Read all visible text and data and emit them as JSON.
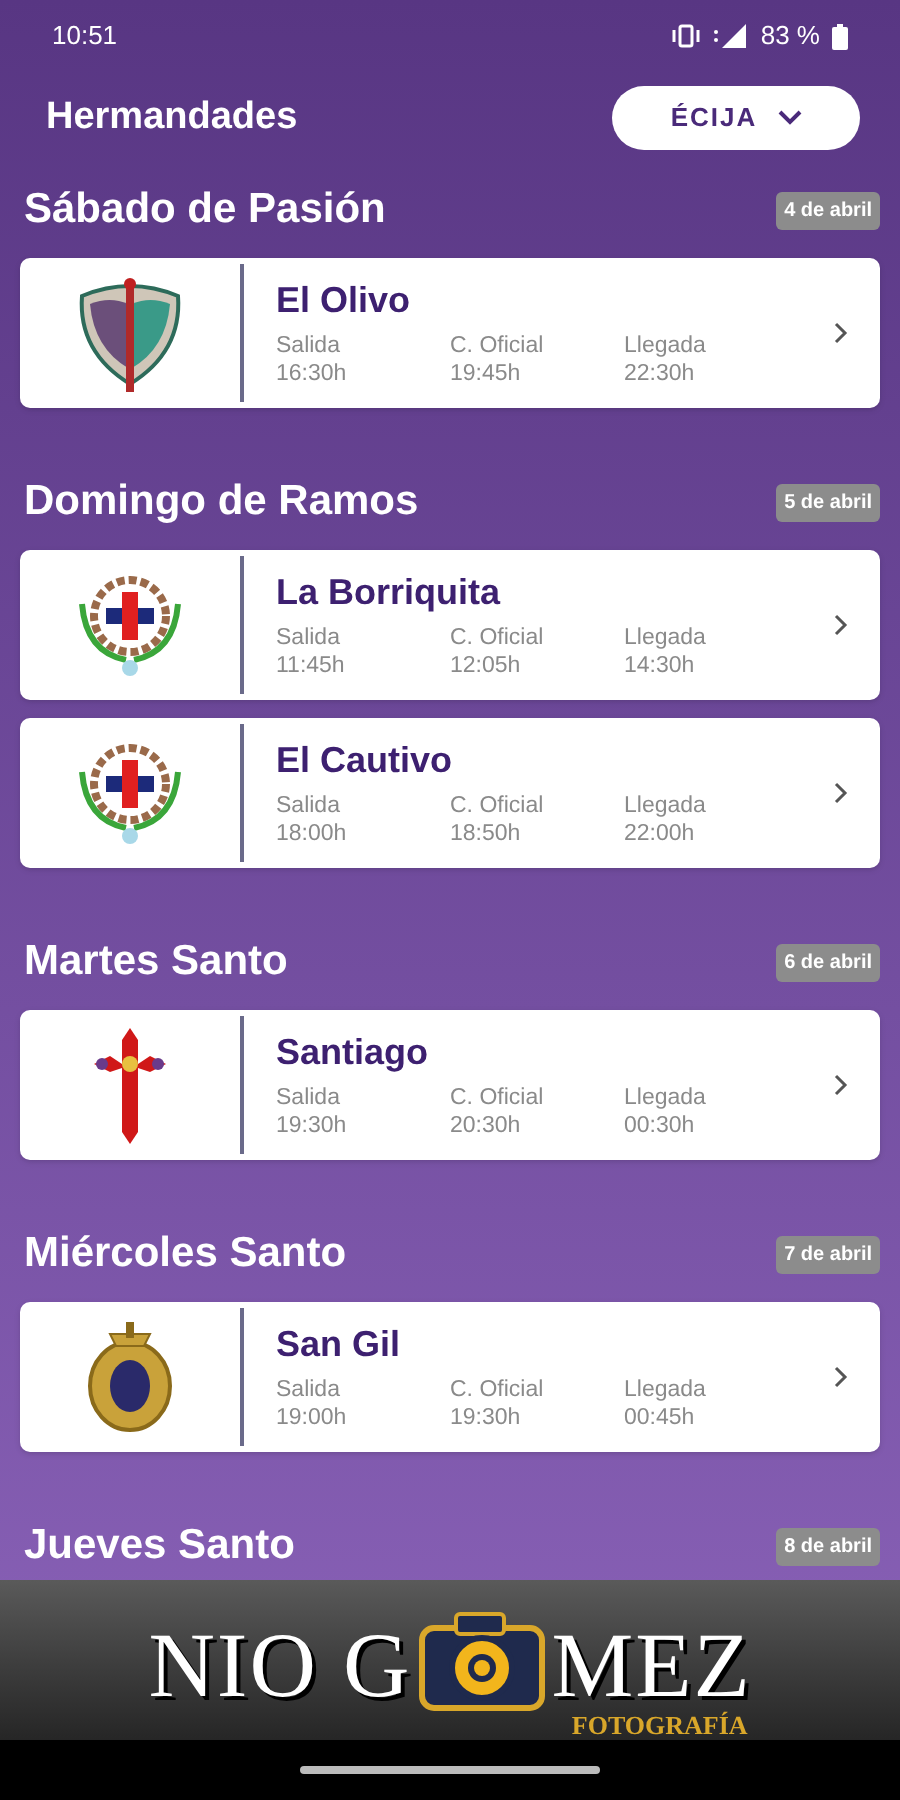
{
  "status_bar": {
    "time": "10:51",
    "battery": "83 %"
  },
  "header": {
    "title": "Hermandades",
    "city_selector": "ÉCIJA"
  },
  "days": [
    {
      "name": "Sábado de Pasión",
      "date": "4 de abril",
      "processions": [
        {
          "name": "El Olivo",
          "kind": "shield",
          "times": [
            {
              "label": "Salida",
              "value": "16:30h"
            },
            {
              "label": "C. Oficial",
              "value": "19:45h"
            },
            {
              "label": "Llegada",
              "value": "22:30h"
            }
          ]
        }
      ]
    },
    {
      "name": "Domingo de Ramos",
      "date": "5 de abril",
      "processions": [
        {
          "name": "La Borriquita",
          "kind": "wreath",
          "times": [
            {
              "label": "Salida",
              "value": "11:45h"
            },
            {
              "label": "C. Oficial",
              "value": "12:05h"
            },
            {
              "label": "Llegada",
              "value": "14:30h"
            }
          ]
        },
        {
          "name": "El Cautivo",
          "kind": "wreath",
          "times": [
            {
              "label": "Salida",
              "value": "18:00h"
            },
            {
              "label": "C. Oficial",
              "value": "18:50h"
            },
            {
              "label": "Llegada",
              "value": "22:00h"
            }
          ]
        }
      ]
    },
    {
      "name": "Martes Santo",
      "date": "6 de abril",
      "processions": [
        {
          "name": "Santiago",
          "kind": "sword-cross",
          "times": [
            {
              "label": "Salida",
              "value": "19:30h"
            },
            {
              "label": "C. Oficial",
              "value": "20:30h"
            },
            {
              "label": "Llegada",
              "value": "00:30h"
            }
          ]
        }
      ]
    },
    {
      "name": "Miércoles Santo",
      "date": "7 de abril",
      "processions": [
        {
          "name": "San Gil",
          "kind": "medallion",
          "times": [
            {
              "label": "Salida",
              "value": "19:00h"
            },
            {
              "label": "C. Oficial",
              "value": "19:30h"
            },
            {
              "label": "Llegada",
              "value": "00:45h"
            }
          ]
        }
      ]
    },
    {
      "name": "Jueves Santo",
      "date": "8 de abril"
    }
  ],
  "banner": {
    "name_left": "NIO G",
    "name_right": "MEZ",
    "subtitle": "FOTOGRAFÍA"
  }
}
